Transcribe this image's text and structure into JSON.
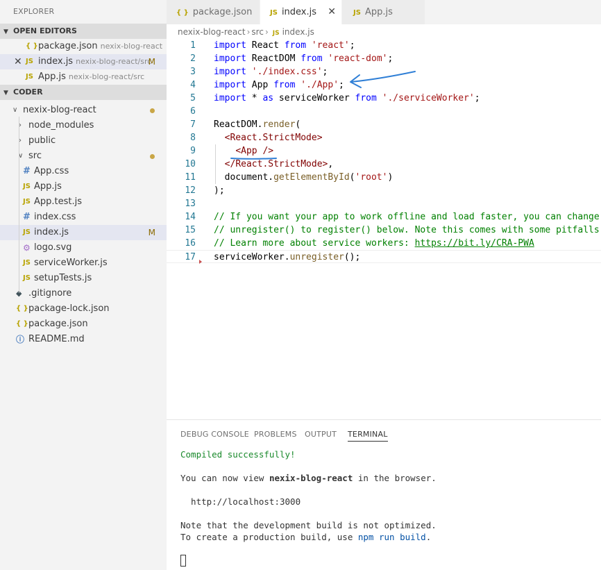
{
  "sidebar": {
    "title": "EXPLORER",
    "open_editors": {
      "header": "OPEN EDITORS",
      "items": [
        {
          "icon": "{ }",
          "name": "package.json",
          "desc": "nexix-blog-react",
          "badge": ""
        },
        {
          "icon": "JS",
          "name": "index.js",
          "desc": "nexix-blog-react/src",
          "badge": "M"
        },
        {
          "icon": "JS",
          "name": "App.js",
          "desc": "nexix-blog-react/src",
          "badge": ""
        }
      ]
    },
    "workspace": {
      "header": "CODER",
      "project": "nexix-blog-react",
      "folders": [
        "node_modules",
        "public",
        "src"
      ],
      "src_files": [
        {
          "icon": "#",
          "name": "App.css",
          "badge": ""
        },
        {
          "icon": "JS",
          "name": "App.js",
          "badge": ""
        },
        {
          "icon": "JS",
          "name": "App.test.js",
          "badge": ""
        },
        {
          "icon": "#",
          "name": "index.css",
          "badge": ""
        },
        {
          "icon": "JS",
          "name": "index.js",
          "badge": "M"
        },
        {
          "icon": "",
          "name": "logo.svg",
          "badge": ""
        },
        {
          "icon": "JS",
          "name": "serviceWorker.js",
          "badge": ""
        },
        {
          "icon": "JS",
          "name": "setupTests.js",
          "badge": ""
        }
      ],
      "root_files": [
        {
          "icon": "",
          "name": ".gitignore"
        },
        {
          "icon": "{ }",
          "name": "package-lock.json"
        },
        {
          "icon": "{ }",
          "name": "package.json"
        },
        {
          "icon": "",
          "name": "README.md"
        }
      ]
    }
  },
  "tabs": [
    {
      "icon": "{ }",
      "label": "package.json"
    },
    {
      "icon": "JS",
      "label": "index.js"
    },
    {
      "icon": "JS",
      "label": "App.js"
    }
  ],
  "breadcrumb": {
    "parts": [
      "nexix-blog-react",
      "src",
      "index.js"
    ],
    "file_icon": "JS"
  },
  "editor": {
    "line_numbers": [
      "1",
      "2",
      "3",
      "4",
      "5",
      "6",
      "7",
      "8",
      "9",
      "10",
      "11",
      "12",
      "13",
      "14",
      "15",
      "16",
      "17"
    ]
  },
  "panel": {
    "tabs": [
      "DEBUG CONSOLE",
      "PROBLEMS",
      "OUTPUT",
      "TERMINAL"
    ],
    "terminal": {
      "compiled": "Compiled successfully!",
      "view_prefix": "You can now view ",
      "app_name": "nexix-blog-react",
      "view_suffix": " in the browser.",
      "url": "  http://localhost:3000",
      "note1": "Note that the development build is not optimized.",
      "note2_prefix": "To create a production build, use ",
      "note2_cmd": "npm run build",
      "note2_suffix": "."
    }
  },
  "colors": {
    "annotation": "#2f7fd6"
  }
}
